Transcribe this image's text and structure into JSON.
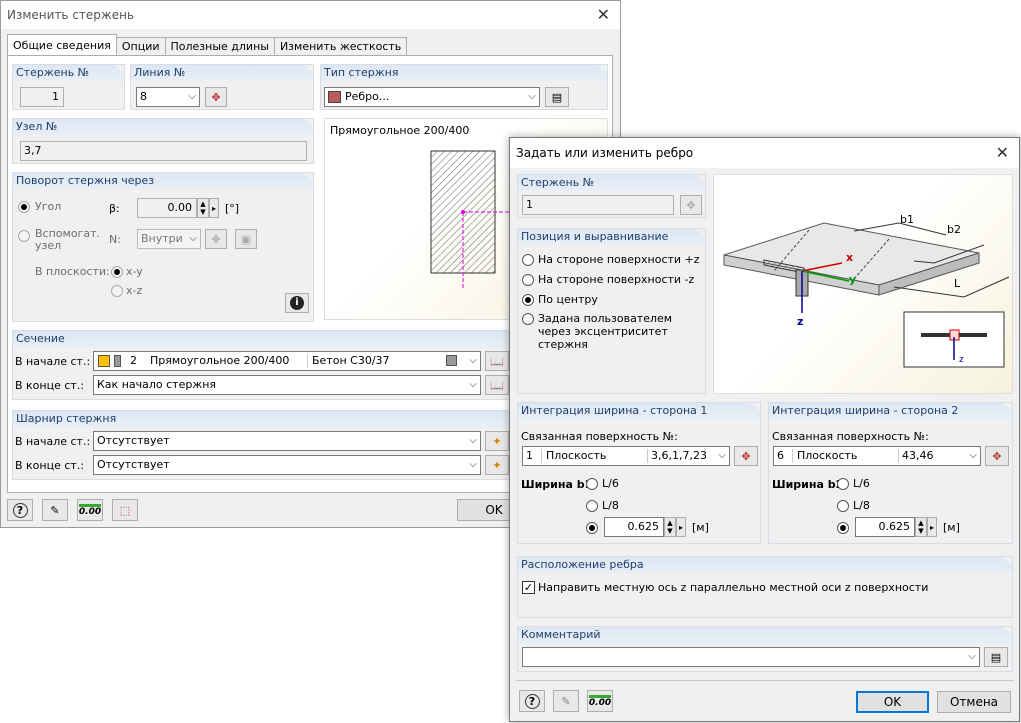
{
  "main": {
    "title": "Изменить стержень",
    "tabs": [
      "Общие сведения",
      "Опции",
      "Полезные длины",
      "Изменить жесткость"
    ],
    "member_no": {
      "label": "Стержень №",
      "value": "1"
    },
    "line_no": {
      "label": "Линия №",
      "value": "8"
    },
    "member_type": {
      "label": "Тип стержня",
      "value": "Ребро...",
      "color": "#b85c5c"
    },
    "node_no": {
      "label": "Узел №",
      "value": "3,7"
    },
    "preview_title": "Прямоугольное 200/400",
    "rotation": {
      "label": "Поворот стержня через",
      "angle_label": "Угол",
      "beta_label": "β:",
      "beta_value": "0.00",
      "unit": "[°]",
      "aux_node_label": "Вспомогат. узел",
      "n_label": "N:",
      "position_value": "Внутри",
      "plane_label": "В плоскости:",
      "xy": "x-y",
      "xz": "x-z"
    },
    "section": {
      "label": "Сечение",
      "start_label": "В начале ст.:",
      "start_no": "2",
      "start_name": "Прямоугольное 200/400",
      "material": "Бетон C30/37",
      "end_label": "В конце ст.:",
      "end_value": "Как начало стержня"
    },
    "hinge": {
      "label": "Шарнир стержня",
      "start_label": "В начале ст.:",
      "start_value": "Отсутствует",
      "end_label": "В конце ст.:",
      "end_value": "Отсутствует"
    },
    "ok": "OK"
  },
  "rib": {
    "title": "Задать или изменить ребро",
    "member_no": {
      "label": "Стержень №",
      "value": "1"
    },
    "position": {
      "label": "Позиция и выравнивание",
      "options": [
        "На стороне поверхности +z",
        "На стороне поверхности -z",
        "По центру",
        "Задана пользователем через эксцентриситет стержня"
      ],
      "selected": 2
    },
    "diagram": {
      "b1": "b1",
      "b2": "b2",
      "x": "x",
      "y": "y",
      "z": "z",
      "L": "L",
      "z2": "z"
    },
    "side1": {
      "label": "Интеграция ширина - сторона 1",
      "surf_label": "Связанная поверхность №:",
      "surf_no": "1",
      "surf_type": "Плоскость",
      "surf_lines": "3,6,1,7,23",
      "width_label": "Ширина b1",
      "opt1": "L/6",
      "opt2": "L/8",
      "value": "0.625",
      "unit": "[м]"
    },
    "side2": {
      "label": "Интеграция ширина - сторона 2",
      "surf_label": "Связанная поверхность №:",
      "surf_no": "6",
      "surf_type": "Плоскость",
      "surf_lines": "43,46",
      "width_label": "Ширина b2",
      "opt1": "L/6",
      "opt2": "L/8",
      "value": "0.625",
      "unit": "[м]"
    },
    "placement": {
      "label": "Расположение ребра",
      "check_label": "Направить местную ось z параллельно местной оси z поверхности",
      "checked": true
    },
    "comment": {
      "label": "Комментарий",
      "value": ""
    },
    "ok": "OK",
    "cancel": "Отмена"
  }
}
